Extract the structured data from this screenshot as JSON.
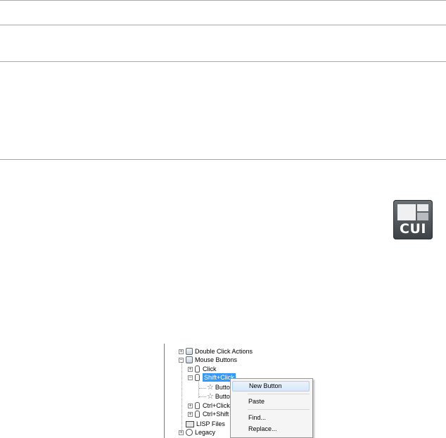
{
  "cui_icon": {
    "label": "CUI"
  },
  "tree": {
    "items": [
      {
        "label": "Double Click Actions"
      },
      {
        "label": "Mouse Buttons"
      },
      {
        "label": "Click"
      },
      {
        "label": "Shift+Click"
      },
      {
        "label": "Butto"
      },
      {
        "label": "Butto"
      },
      {
        "label": "Ctrl+Click"
      },
      {
        "label": "Ctrl+Shift"
      },
      {
        "label": "LISP Files"
      },
      {
        "label": "Legacy"
      }
    ],
    "selected_color": "#3399ff"
  },
  "context_menu": {
    "items": [
      {
        "label": "New Button"
      },
      {
        "label": "Paste"
      },
      {
        "label": "Find..."
      },
      {
        "label": "Replace..."
      }
    ]
  }
}
